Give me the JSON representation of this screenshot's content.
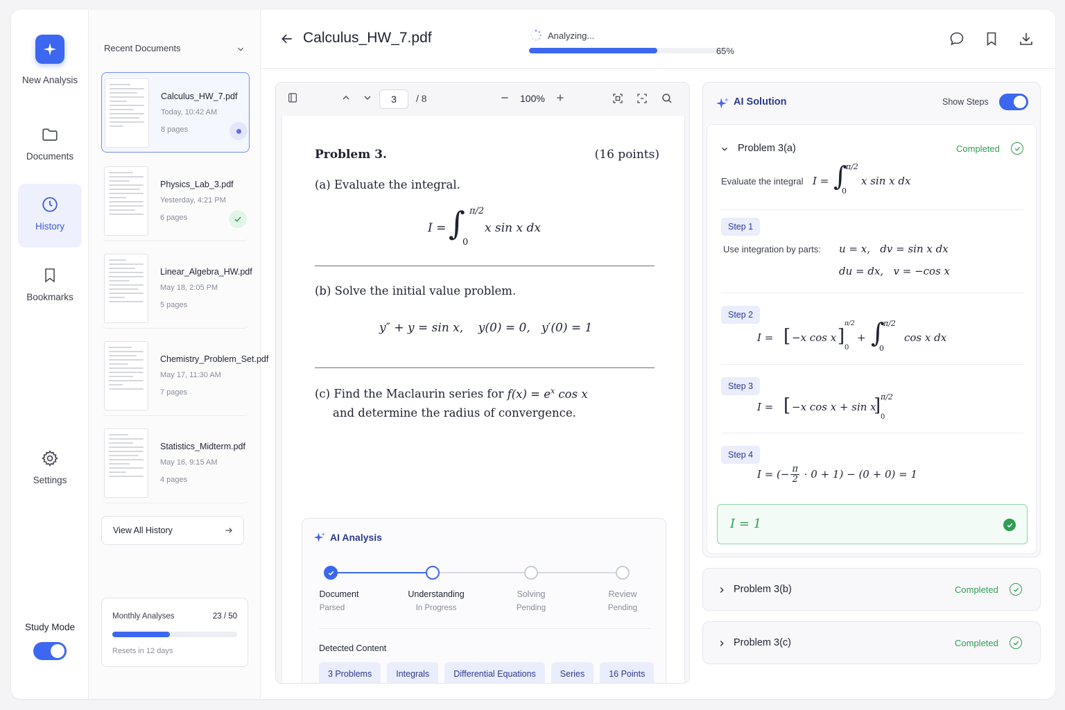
{
  "rail": {
    "new_analysis": "New Analysis",
    "items": [
      {
        "label": "Documents",
        "icon": "folder-icon"
      },
      {
        "label": "History",
        "icon": "clock-icon",
        "active": true
      },
      {
        "label": "Bookmarks",
        "icon": "bookmark-icon"
      },
      {
        "label": "Settings",
        "icon": "gear-icon"
      }
    ],
    "study_mode": "Study Mode",
    "study_mode_on": true
  },
  "docs": {
    "header": "Recent Documents",
    "items": [
      {
        "name": "Calculus_HW_7.pdf",
        "date": "Today, 10:42 AM",
        "pages": "8 pages",
        "status": "in-progress"
      },
      {
        "name": "Physics_Lab_3.pdf",
        "date": "Yesterday, 4:21 PM",
        "pages": "6 pages",
        "status": "done"
      },
      {
        "name": "Linear_Algebra_HW.pdf",
        "date": "May 18, 2:05 PM",
        "pages": "5 pages",
        "status": ""
      },
      {
        "name": "Chemistry_Problem_Set.pdf",
        "date": "May 17, 11:30 AM",
        "pages": "7 pages",
        "status": ""
      },
      {
        "name": "Statistics_Midterm.pdf",
        "date": "May 16, 9:15 AM",
        "pages": "4 pages",
        "status": ""
      }
    ],
    "view_all": "View All History",
    "usage": {
      "title": "Monthly Analyses",
      "count": "23 / 50",
      "used": 23,
      "limit": 50,
      "reset": "Resets in 12 days"
    }
  },
  "header": {
    "title": "Calculus_HW_7.pdf",
    "status": "Analyzing...",
    "progress_pct": 65,
    "progress_label": "65%"
  },
  "viewer": {
    "page": "3",
    "total": "/ 8",
    "zoom": "100%",
    "problem_title": "Problem 3.",
    "points": "(16 points)",
    "part_a": "(a) Evaluate the integral.",
    "part_b": "(b) Solve the initial value problem.",
    "part_c_1": "(c) Find the Maclaurin series for",
    "part_c_2": "and determine the radius of convergence."
  },
  "analysis": {
    "title": "AI Analysis",
    "steps": [
      {
        "label": "Document",
        "sub": "Parsed",
        "state": "done"
      },
      {
        "label": "Understanding",
        "sub": "In Progress",
        "state": "current"
      },
      {
        "label": "Solving",
        "sub": "Pending",
        "state": "pending"
      },
      {
        "label": "Review",
        "sub": "Pending",
        "state": "pending"
      }
    ],
    "detected_title": "Detected Content",
    "chips": [
      "3 Problems",
      "Integrals",
      "Differential Equations",
      "Series",
      "16 Points"
    ]
  },
  "solution": {
    "title": "AI Solution",
    "show_steps": "Show Steps",
    "show_steps_on": true,
    "problem_a": "Problem 3(a)",
    "completed": "Completed",
    "eval_text": "Evaluate the integral",
    "step1": "Step 1",
    "step1_text": "Use integration by parts:",
    "step2": "Step 2",
    "step3": "Step 3",
    "step4": "Step 4",
    "problem_b": "Problem 3(b)",
    "problem_c": "Problem 3(c)"
  },
  "colors": {
    "accent": "#3c67f0",
    "success": "#2f9e52",
    "chip_bg": "#eaedfb"
  }
}
